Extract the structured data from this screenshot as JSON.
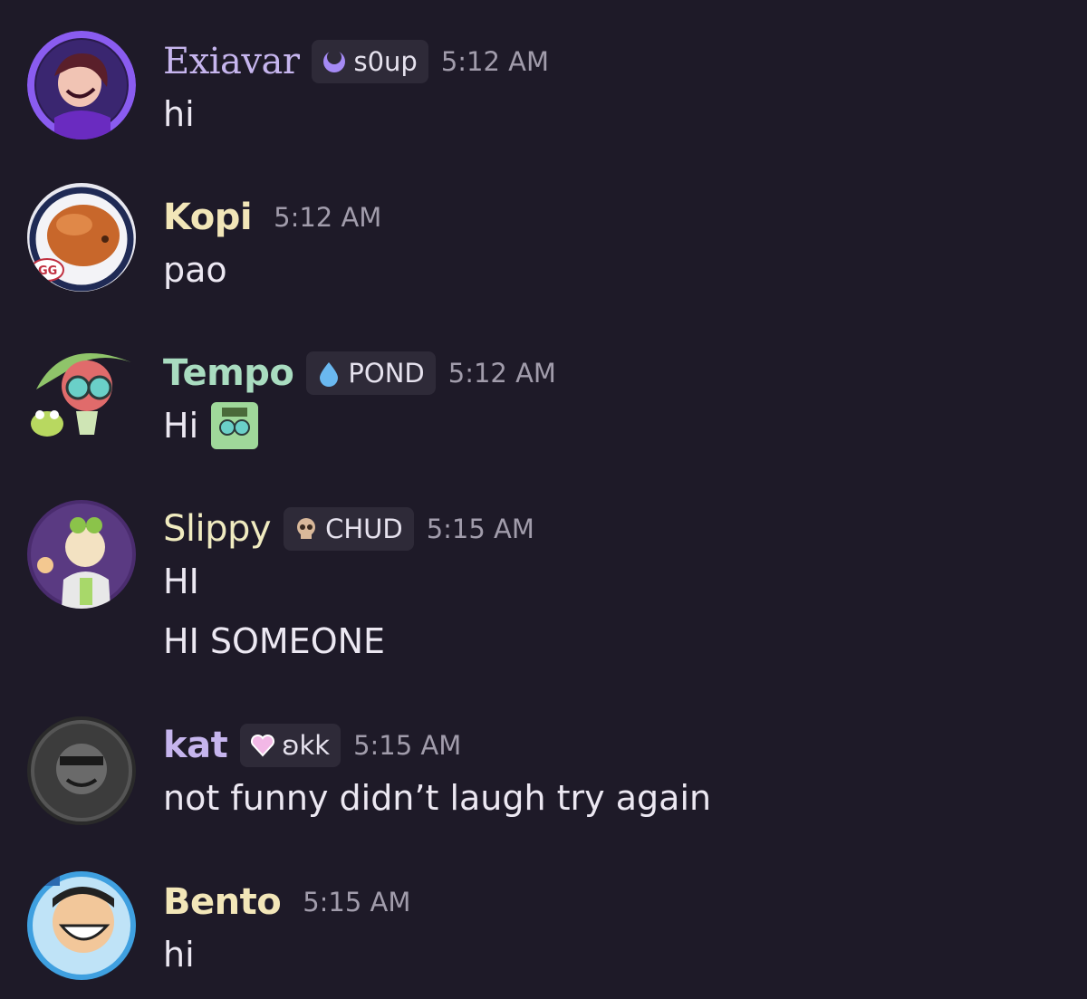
{
  "colors": {
    "background": "#1e1a28",
    "text": "#ece8f2",
    "timestamp": "#a19cab",
    "badge_bg": "#2e2a38"
  },
  "messages": [
    {
      "author": "Exiavar",
      "author_color": "#c6b5ee",
      "avatar_icon": "purple-portrait-avatar",
      "badge": {
        "icon": "crescent-moon-icon",
        "label": "s0up"
      },
      "time": "5:12 AM",
      "lines": [
        "hi"
      ]
    },
    {
      "author": "Kopi",
      "author_color": "#f2e6b8",
      "avatar_icon": "orange-blob-avatar",
      "time": "5:12 AM",
      "lines": [
        "pao"
      ]
    },
    {
      "author": "Tempo",
      "author_color": "#a9dcc0",
      "avatar_icon": "frog-character-avatar",
      "badge": {
        "icon": "water-drop-icon",
        "label": "POND"
      },
      "time": "5:12 AM",
      "lines": [
        "Hi"
      ],
      "sticker": "green-frog-emoji"
    },
    {
      "author": "Slippy",
      "author_color": "#f0ebc0",
      "avatar_icon": "goggles-character-avatar",
      "badge": {
        "icon": "skull-icon",
        "label": "CHUD"
      },
      "time": "5:15 AM",
      "lines": [
        "HI",
        "HI SOMEONE"
      ]
    },
    {
      "author": "kat",
      "author_color": "#c6b5ee",
      "avatar_icon": "dark-gray-avatar",
      "badge": {
        "icon": "pink-heart-icon",
        "label": "ʚkk"
      },
      "time": "5:15 AM",
      "lines": [
        "not funny didn’t laugh try again"
      ]
    },
    {
      "author": "Bento",
      "author_color": "#f2e6b8",
      "avatar_icon": "grinning-face-avatar",
      "time": "5:15 AM",
      "lines": [
        "hi"
      ]
    }
  ]
}
